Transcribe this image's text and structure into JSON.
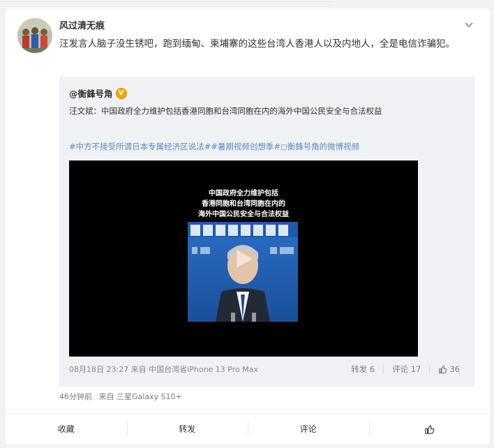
{
  "post": {
    "username": "风过清无痕",
    "text": "汪发言人脑子没生锈吧，跑到缅甸、柬埔寨的这些台湾人香港人以及内地人，全是电信诈骗犯。",
    "time": "46分钟前",
    "source": "来自 三星Galaxy S10+"
  },
  "repost": {
    "author": "@衡鋒号角",
    "badge": "V",
    "text": "汪文斌：中国政府全力维护包括香港同胞和台湾同胞在内的海外中国公民安全与合法权益",
    "hashtags": [
      "#中方不接受所谓日本专属经济区说法#",
      "#暑期视频创想季#",
      " ◻衡鋒号角的微博视频"
    ],
    "video_caption": [
      "中国政府全力维护包括",
      "香港同胞和台湾同胞在内的",
      "海外中国公民安全与合法权益"
    ],
    "meta": "08月18日 23:27  来自 中国台湾省iPhone 13 Pro Max",
    "stats": {
      "repost_label": "转发 6",
      "comment_label": "评论 17",
      "like_count": "36"
    }
  },
  "actions": {
    "collect": "收藏",
    "repost": "转发",
    "comment": "评论"
  },
  "icons": {
    "chevron": "chevron-down-icon",
    "like": "thumb-up-icon",
    "play": "play-icon"
  },
  "colors": {
    "link": "#5a8cbe",
    "badge": "#f6a700"
  }
}
